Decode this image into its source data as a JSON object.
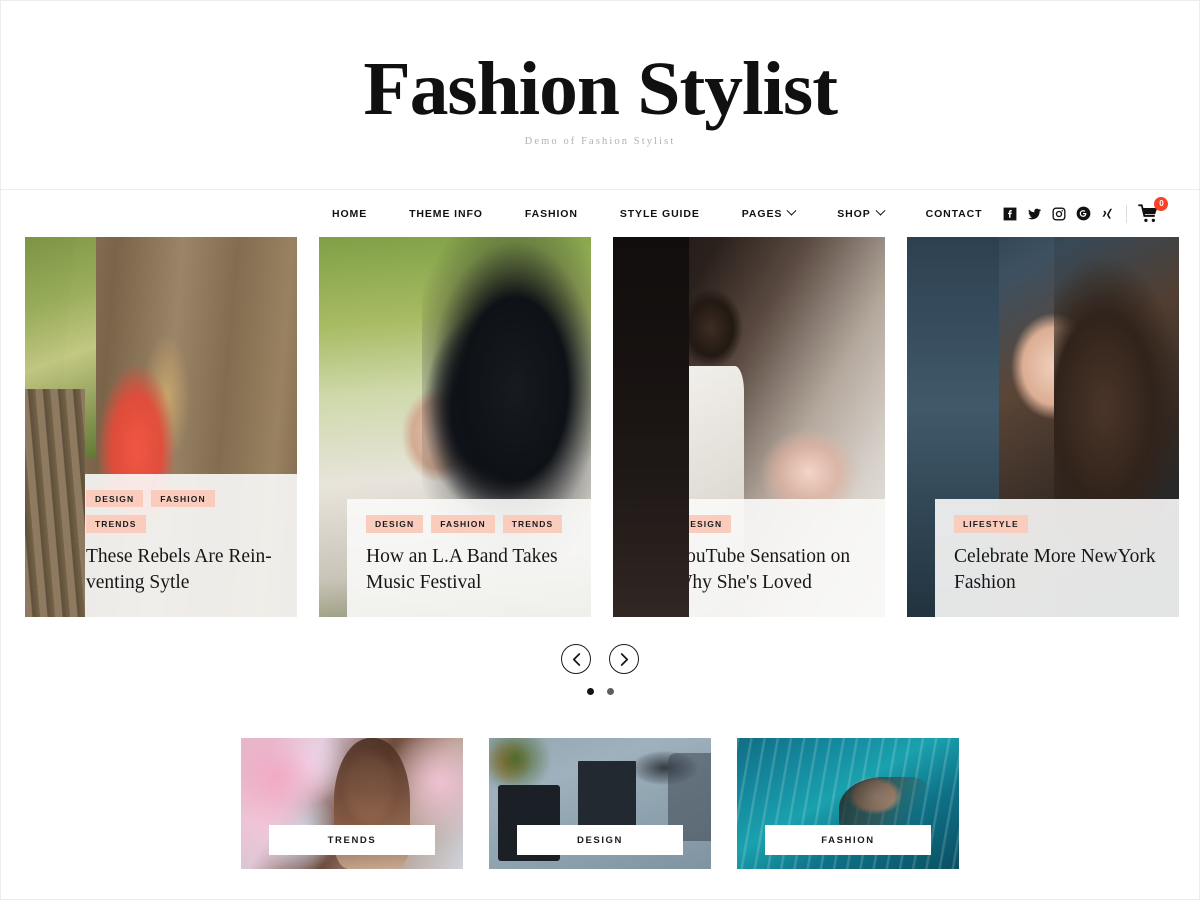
{
  "header": {
    "title": "Fashion Stylist",
    "tagline": "Demo of Fashion Stylist"
  },
  "nav": {
    "items": [
      {
        "label": "HOME",
        "has_dropdown": false
      },
      {
        "label": "THEME INFO",
        "has_dropdown": false
      },
      {
        "label": "FASHION",
        "has_dropdown": false
      },
      {
        "label": "STYLE GUIDE",
        "has_dropdown": false
      },
      {
        "label": "PAGES",
        "has_dropdown": true
      },
      {
        "label": "SHOP",
        "has_dropdown": true
      },
      {
        "label": "CONTACT",
        "has_dropdown": false
      }
    ],
    "social": [
      {
        "name": "facebook-icon"
      },
      {
        "name": "twitter-icon"
      },
      {
        "name": "instagram-icon"
      },
      {
        "name": "googleplus-icon"
      },
      {
        "name": "xing-icon"
      }
    ],
    "cart": {
      "icon": "shopping-cart-icon",
      "count": "0",
      "badge_color": "#f8432a"
    }
  },
  "slider": {
    "cards": [
      {
        "tags": [
          "DESIGN",
          "FASHION",
          "TRENDS"
        ],
        "title": "These Rebels Are Rein-venting Sytle",
        "image": "woman-in-red-dress-by-log-cabin"
      },
      {
        "tags": [
          "DESIGN",
          "FASHION",
          "TRENDS"
        ],
        "title": "How an L.A Band Takes Music Festival",
        "image": "woman-with-dark-hair-outdoors"
      },
      {
        "tags": [
          "DESIGN"
        ],
        "title": "YouTube Sensation on Why She's Loved",
        "image": "man-holding-roses"
      },
      {
        "tags": [
          "LIFESTYLE"
        ],
        "title": "Celebrate More NewYork Fashion",
        "image": "woman-with-windblown-hair"
      }
    ],
    "controls": {
      "prev_label": "Previous slide",
      "next_label": "Next slide",
      "dots": [
        {
          "active": true
        },
        {
          "active": false
        }
      ]
    }
  },
  "categories": [
    {
      "label": "TRENDS",
      "image": "bride-with-flowers"
    },
    {
      "label": "DESIGN",
      "image": "desk-workspace-flatlay"
    },
    {
      "label": "FASHION",
      "image": "woman-floating-in-water"
    }
  ],
  "colors": {
    "tag_background": "#f9ccbd",
    "cart_badge": "#f8432a",
    "text_dark": "#111111",
    "tagline": "#b5b0ae"
  }
}
